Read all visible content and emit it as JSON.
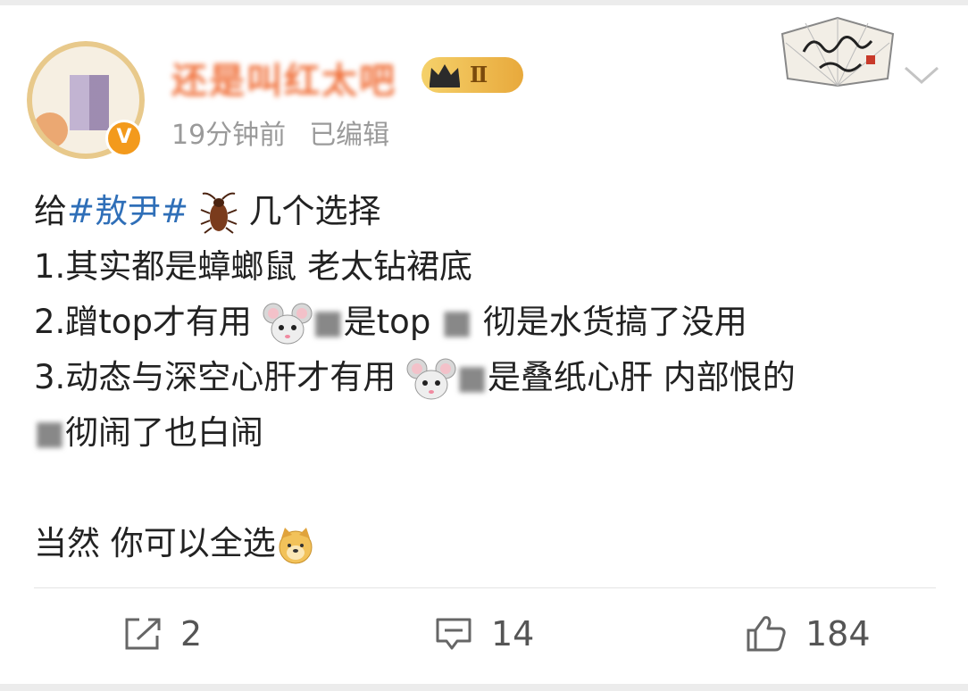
{
  "post": {
    "username": "还是叫红太吧",
    "level_badge": "Ⅱ",
    "time": "19分钟前",
    "edited": "已编辑",
    "text": {
      "l1_prefix": "给",
      "l1_tag": "#敖尹#",
      "l1_suffix": "几个选择",
      "l2": "1.其实都是蟑螂鼠 老太钻裙底",
      "l3_a": "2.蹭top才有用 ",
      "l3_b": "是top",
      "l3_c": "彻是水货搞了没用",
      "l4_a": "3.动态与深空心肝才有用 ",
      "l4_b": "是叠纸心肝 内部恨的",
      "l5": "彻闹了也白闹",
      "l6": "当然 你可以全选"
    }
  },
  "actions": {
    "repost_count": "2",
    "comment_count": "14",
    "like_count": "184"
  },
  "icons": [
    "avatar",
    "verified-v-icon",
    "crown-level-badge-icon",
    "fan-decoration",
    "chevron-down-icon",
    "cockroach-emoji",
    "mouse-emoji",
    "doge-emoji",
    "repost-icon",
    "comment-icon",
    "like-icon"
  ],
  "colors": {
    "username": "#f0703a",
    "tag": "#2f6fb8",
    "meta": "#9a9a9a"
  }
}
